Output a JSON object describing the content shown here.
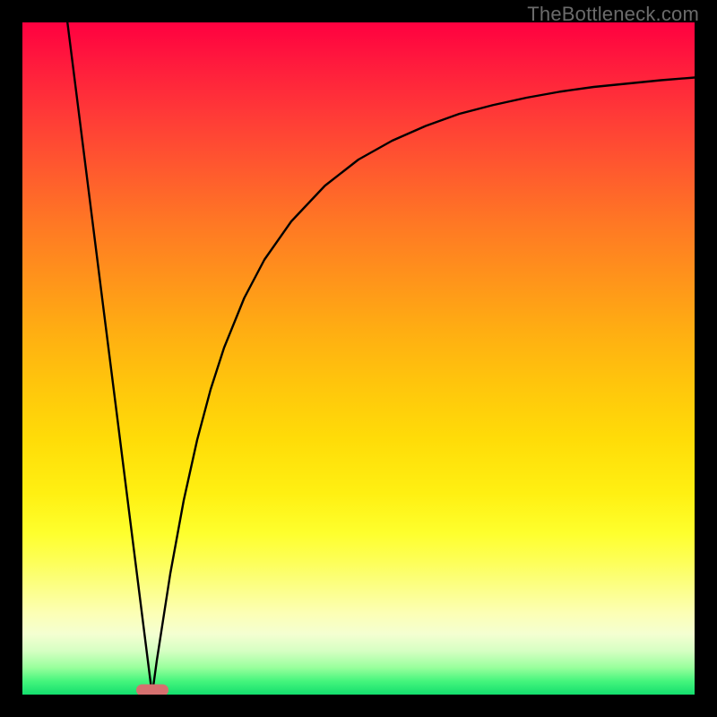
{
  "watermark": "TheBottleneck.com",
  "chart_data": {
    "type": "line",
    "title": "",
    "xlabel": "",
    "ylabel": "",
    "xlim": [
      0,
      100
    ],
    "ylim": [
      0,
      100
    ],
    "grid": false,
    "legend": false,
    "series": [
      {
        "name": "left-branch",
        "x": [
          6.7,
          8,
          10,
          12,
          14,
          16,
          18,
          19.3
        ],
        "y": [
          100,
          89.7,
          73.8,
          57.9,
          42.1,
          26.2,
          10.3,
          0
        ]
      },
      {
        "name": "right-branch",
        "x": [
          19.3,
          20,
          22,
          24,
          26,
          28,
          30,
          33,
          36,
          40,
          45,
          50,
          55,
          60,
          65,
          70,
          75,
          80,
          85,
          90,
          95,
          100
        ],
        "y": [
          0,
          5.1,
          18.0,
          28.9,
          37.9,
          45.4,
          51.6,
          59.0,
          64.7,
          70.4,
          75.7,
          79.6,
          82.4,
          84.6,
          86.4,
          87.7,
          88.8,
          89.7,
          90.4,
          90.9,
          91.4,
          91.8
        ]
      }
    ],
    "annotations": [
      {
        "name": "minimum-marker",
        "x": 19.3,
        "y": 0
      }
    ],
    "background_gradient": {
      "direction": "vertical",
      "stops": [
        {
          "pos": 0.0,
          "color": "#ff0040"
        },
        {
          "pos": 0.5,
          "color": "#ffbe0c"
        },
        {
          "pos": 0.78,
          "color": "#feff40"
        },
        {
          "pos": 0.92,
          "color": "#e8ffc8"
        },
        {
          "pos": 1.0,
          "color": "#13de6e"
        }
      ]
    }
  },
  "marker": {
    "label": ""
  }
}
